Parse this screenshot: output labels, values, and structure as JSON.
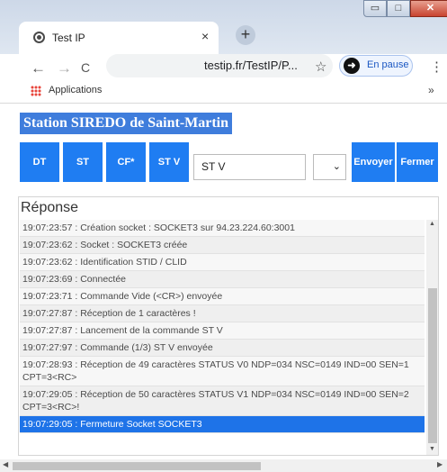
{
  "browser": {
    "tab_title": "Test IP",
    "tab_close": "×",
    "new_tab": "+",
    "window_buttons": {
      "minimize": "▭",
      "maximize": "□",
      "close": "✕"
    },
    "nav": {
      "back": "←",
      "forward": "→",
      "reload": "C"
    },
    "url": "testip.fr/TestIP/P...",
    "star": "☆",
    "pause_label": "En pause",
    "menu": "⋮",
    "bookmarks": {
      "apps_label": "Applications",
      "more": "»"
    }
  },
  "page": {
    "station_title": "Station SIREDO de Saint-Martin",
    "buttons": {
      "dt": "DT",
      "st": "ST",
      "cf": "CF*",
      "stv": "ST V",
      "send": "Envoyer",
      "close": "Fermer"
    },
    "command_value": "ST V",
    "select_value": "⌄",
    "response": {
      "title": "Réponse",
      "lines": [
        "19:07:23:57 : Création socket : SOCKET3 sur 94.23.224.60:3001",
        "19:07:23:62 : Socket : SOCKET3 créée",
        "19:07:23:62 : Identification STID / CLID",
        "19:07:23:69 : Connectée",
        "19:07:23:71 : Commande Vide (<CR>) envoyée",
        "19:07:27:87 : Réception de 1 caractères !",
        "19:07:27:87 : Lancement de la commande ST V",
        "19:07:27:97 : Commande (1/3) ST V envoyée",
        "19:07:28:93 : Réception de 49 caractères STATUS V0 NDP=034 NSC=0149 IND=00 SEN=1 CPT=3<RC>",
        "19:07:29:05 : Réception de 50 caractères STATUS V1 NDP=034 NSC=0149 IND=00 SEN=2 CPT=3<RC>!",
        "19:07:29:05 : Fermeture Socket SOCKET3"
      ]
    }
  },
  "colors": {
    "accent": "#1f7df2",
    "station_bg": "#3f7ddc",
    "selected_row": "#1e73e8"
  }
}
